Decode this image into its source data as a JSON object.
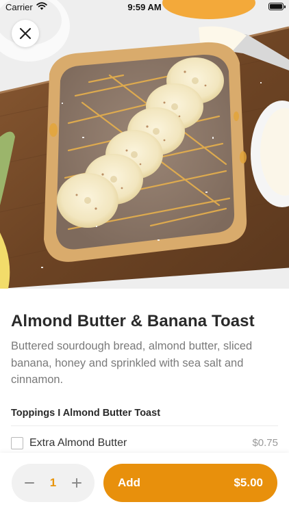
{
  "status_bar": {
    "carrier": "Carrier",
    "time": "9:59 AM",
    "icons": [
      "wifi-icon",
      "battery-icon"
    ]
  },
  "hero": {
    "image": "almond-butter-banana-toast-photo",
    "close_icon": "close-icon"
  },
  "item": {
    "title": "Almond Butter & Banana Toast",
    "description": "Buttered sourdough bread, almond butter, sliced banana, honey and sprinkled with sea salt and cinnamon."
  },
  "toppings": {
    "header": "Toppings I Almond Butter Toast",
    "options": [
      {
        "label": "Extra Almond Butter",
        "price": "$0.75",
        "checked": false
      }
    ]
  },
  "order": {
    "quantity": "1",
    "minus_icon": "minus-icon",
    "plus_icon": "plus-icon",
    "add_label": "Add",
    "total": "$5.00"
  },
  "colors": {
    "accent": "#e8900c",
    "stepper_bg": "#f1f1f1",
    "quantity_text": "#e8940b"
  }
}
